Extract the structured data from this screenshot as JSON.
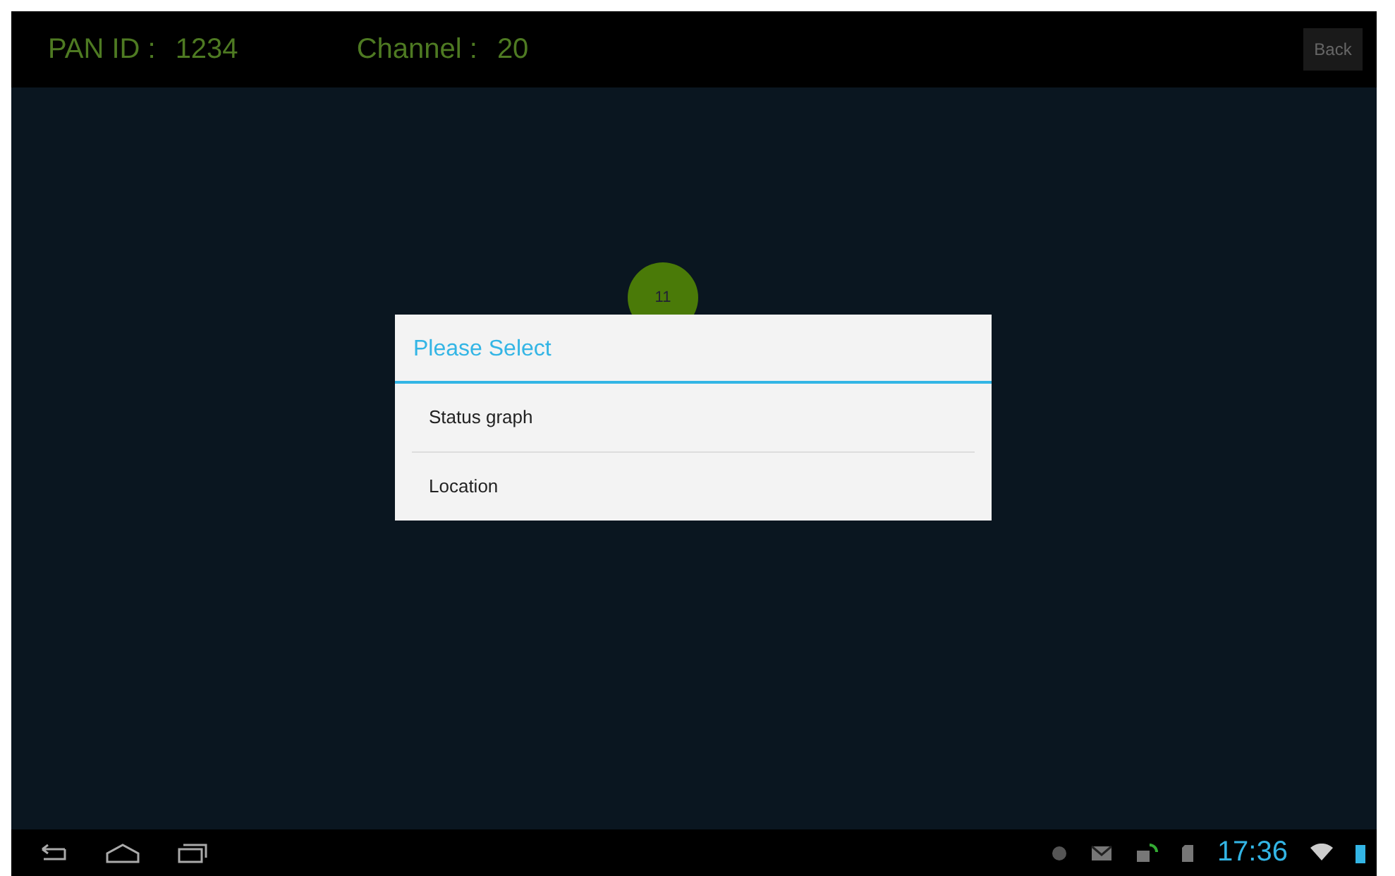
{
  "header": {
    "pan_id_label": "PAN ID :",
    "pan_id": "1234",
    "channel_label": "Channel :",
    "channel": "20",
    "back_button": "Back"
  },
  "nodes": [
    {
      "label": "11",
      "color": "#4a7a08"
    }
  ],
  "dialog": {
    "title": "Please Select",
    "items": [
      {
        "label": "Status graph"
      },
      {
        "label": "Location"
      }
    ]
  },
  "status_bar": {
    "time": "17:36"
  }
}
